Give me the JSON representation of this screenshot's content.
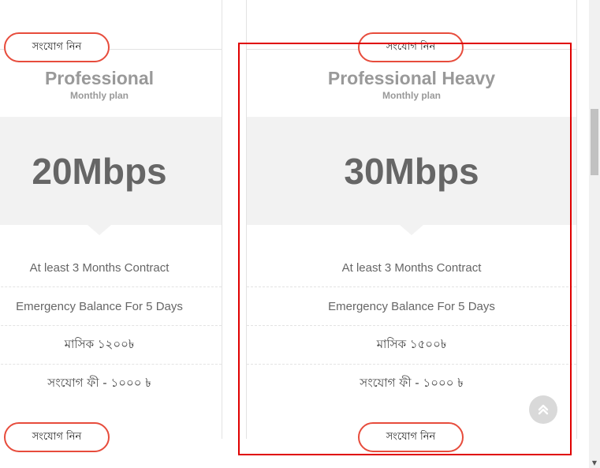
{
  "plans": [
    {
      "title": "Professional",
      "subtitle": "Monthly plan",
      "speed": "20Mbps",
      "features": [
        "At least 3 Months Contract",
        "Emergency Balance For 5 Days",
        "মাসিক ১২০০৳",
        "সংযোগ ফী - ১০০০ ৳"
      ],
      "cta_label": "সংযোগ নিন"
    },
    {
      "title": "Professional Heavy",
      "subtitle": "Monthly plan",
      "speed": "30Mbps",
      "features": [
        "At least 3 Months Contract",
        "Emergency Balance For 5 Days",
        "মাসিক ১৫০০৳",
        "সংযোগ ফী - ১০০০ ৳"
      ],
      "cta_label": "সংযোগ নিন"
    }
  ],
  "prev_cards": [
    {
      "cta_label": "সংযোগ নিন"
    },
    {
      "cta_label": "সংযোগ নিন"
    }
  ],
  "colors": {
    "accent": "#e74c3c",
    "highlight": "#e00000",
    "band": "#f2f2f2"
  },
  "icons": {
    "scroll_top": "double-chevron-up-icon",
    "scroll_down": "arrow-down-icon"
  }
}
